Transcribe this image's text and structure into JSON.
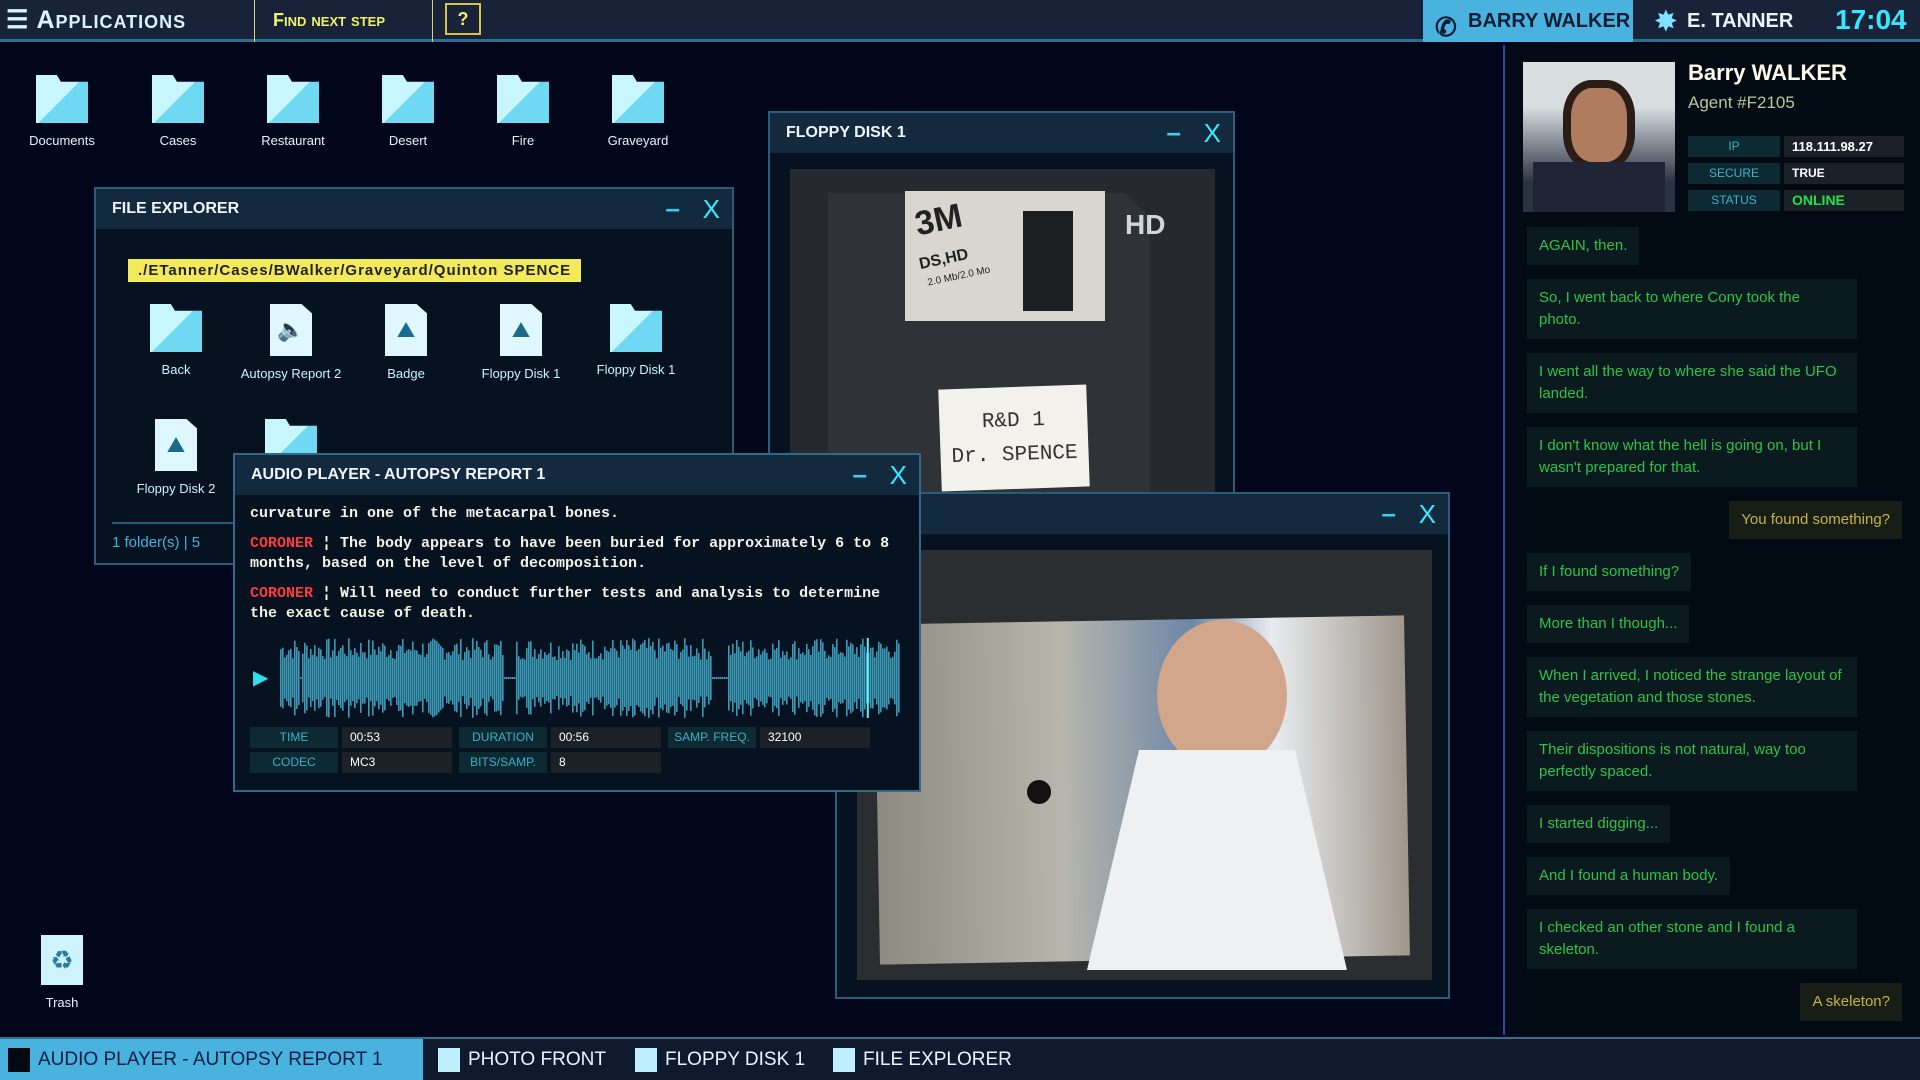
{
  "topbar": {
    "apps_label": "Applications",
    "find_next_step": "Find next step",
    "help": "?",
    "call_name": "BARRY WALKER",
    "user_name": "E. TANNER",
    "clock": "17:04"
  },
  "desktop": {
    "icons": [
      {
        "label": "Documents"
      },
      {
        "label": "Cases"
      },
      {
        "label": "Restaurant"
      },
      {
        "label": "Desert"
      },
      {
        "label": "Fire"
      },
      {
        "label": "Graveyard"
      }
    ],
    "trash": "Trash"
  },
  "file_explorer": {
    "title": "FILE EXPLORER",
    "minimize": "–",
    "close": "X",
    "path": "./ETanner/Cases/BWalker/Graveyard/Quinton SPENCE",
    "items": [
      {
        "label": "Back",
        "type": "back"
      },
      {
        "label": "Autopsy Report 2",
        "type": "audio"
      },
      {
        "label": "Badge",
        "type": "image"
      },
      {
        "label": "Floppy Disk 1",
        "type": "image"
      },
      {
        "label": "Floppy Disk 1",
        "type": "folder"
      },
      {
        "label": "Floppy Disk 2",
        "type": "image"
      },
      {
        "label": "",
        "type": "folder"
      }
    ],
    "status": "1 folder(s)  |  5"
  },
  "floppy_window": {
    "title": "FLOPPY DISK 1",
    "minimize": "–",
    "close": "X",
    "brand": "3M",
    "disk_type": "DS,HD",
    "disk_capacity": "2.0 Mb/2.0 Mo",
    "hd_mark": "HD",
    "label_line1": "R&D 1",
    "label_line2": "Dr. SPENCE"
  },
  "photo_window": {
    "title": "",
    "minimize": "–",
    "close": "X"
  },
  "audio_player": {
    "title": "AUDIO PLAYER - AUTOPSY REPORT 1",
    "minimize": "–",
    "close": "X",
    "transcript": [
      {
        "speaker": "",
        "text": "curvature in one of the metacarpal bones."
      },
      {
        "speaker": "CORONER",
        "text": "The body appears to have been buried for approximately 6 to 8 months, based on the level of decomposition."
      },
      {
        "speaker": "CORONER",
        "text": "Will need to conduct further tests and analysis to determine the exact cause of death."
      }
    ],
    "progress_seconds": 53,
    "duration_seconds": 56,
    "fields": {
      "time_label": "TIME",
      "time": "00:53",
      "duration_label": "DURATION",
      "duration": "00:56",
      "freq_label": "SAMP. FREQ.",
      "freq": "32100",
      "codec_label": "CODEC",
      "codec": "MC3",
      "bits_label": "BITS/SAMP.",
      "bits": "8"
    }
  },
  "profile": {
    "name": "Barry WALKER",
    "agent": "Agent #F2105",
    "ip_label": "IP",
    "ip": "118.111.98.27",
    "secure_label": "SECURE",
    "secure": "TRUE",
    "status_label": "STATUS",
    "status": "ONLINE",
    "status_color": "#22e04a"
  },
  "chat": [
    {
      "from": "them",
      "text": "AGAIN, then."
    },
    {
      "from": "them",
      "text": "So, I went back to where Cony took the photo."
    },
    {
      "from": "them",
      "text": "I went all the way to where she said the UFO landed."
    },
    {
      "from": "them",
      "text": "I don't know what the hell is going on, but I wasn't prepared for that."
    },
    {
      "from": "me",
      "text": "You found something?"
    },
    {
      "from": "them",
      "text": "If I found something?"
    },
    {
      "from": "them",
      "text": "More than I though..."
    },
    {
      "from": "them",
      "text": "When I arrived, I noticed the strange layout of the vegetation and those stones."
    },
    {
      "from": "them",
      "text": "Their dispositions is not natural, way too perfectly spaced."
    },
    {
      "from": "them",
      "text": "I started digging..."
    },
    {
      "from": "them",
      "text": "And I found a human body."
    },
    {
      "from": "them",
      "text": "I checked an other stone and I found a skeleton."
    },
    {
      "from": "me",
      "text": "A skeleton?"
    }
  ],
  "taskbar": [
    {
      "label": "AUDIO PLAYER - AUTOPSY REPORT 1",
      "active": true
    },
    {
      "label": "PHOTO FRONT"
    },
    {
      "label": "FLOPPY DISK 1"
    },
    {
      "label": "FILE EXPLORER"
    }
  ]
}
